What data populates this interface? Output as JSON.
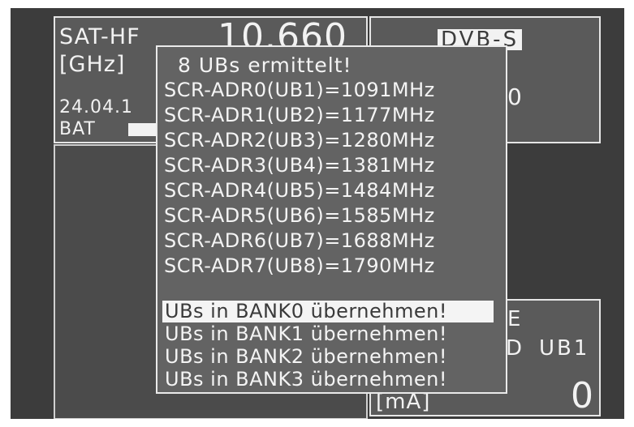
{
  "left_panel": {
    "mode_label": "SAT-HF",
    "frequency_value": "10.660",
    "unit_label": "[GHz]",
    "date_text": "24.04.1",
    "battery_label": "BAT"
  },
  "right_panel": {
    "standard_label": "DVB-S",
    "value_partial": "0"
  },
  "bottom_right_panel": {
    "label_partial": "E",
    "prefix_partial": "D",
    "ub_label": "UB1",
    "unit_label": "[mA]",
    "current_value": "0"
  },
  "popup": {
    "header": "8 UBs ermittelt!",
    "entries": [
      "SCR-ADR0(UB1)=1091MHz",
      "SCR-ADR1(UB2)=1177MHz",
      "SCR-ADR2(UB3)=1280MHz",
      "SCR-ADR3(UB4)=1381MHz",
      "SCR-ADR4(UB5)=1484MHz",
      "SCR-ADR5(UB6)=1585MHz",
      "SCR-ADR6(UB7)=1688MHz",
      "SCR-ADR7(UB8)=1790MHz"
    ],
    "options": [
      "UBs in BANK0 übernehmen!",
      "UBs in BANK1 übernehmen!",
      "UBs in BANK2 übernehmen!",
      "UBs in BANK3 übernehmen!"
    ],
    "selected_option": 0
  }
}
